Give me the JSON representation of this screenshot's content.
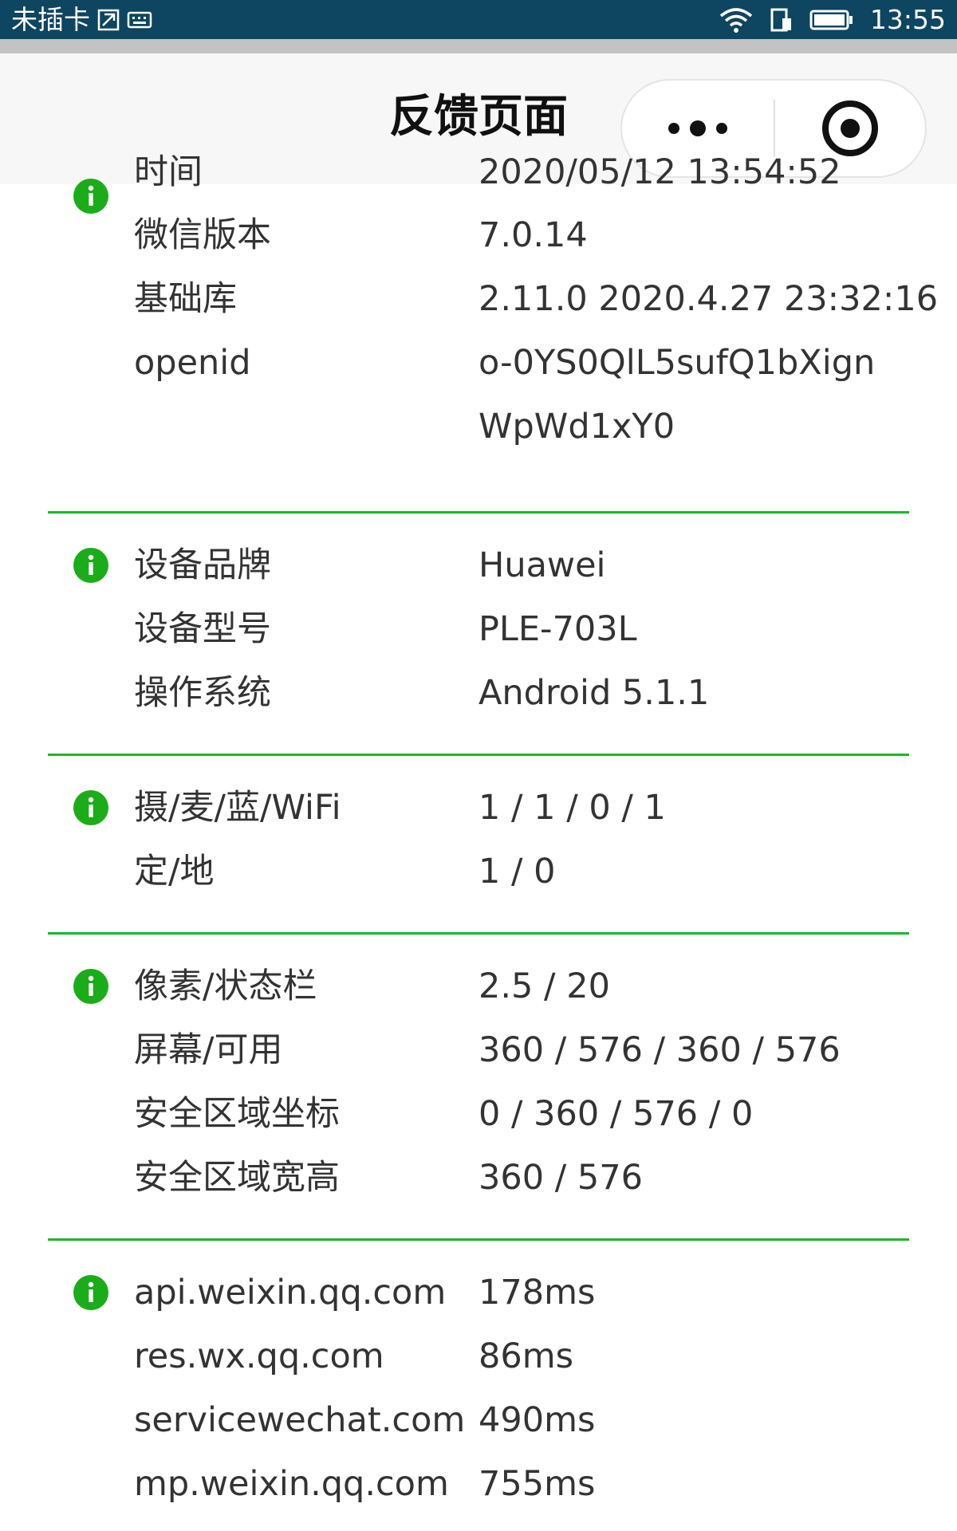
{
  "status_bar": {
    "carrier": "未插卡",
    "time": "13:55",
    "icons": [
      "sim-icon",
      "keyboard-icon",
      "wifi-icon",
      "sim-data-icon",
      "battery-icon"
    ]
  },
  "nav": {
    "title": "反馈页面",
    "more_icon": "more-dots-icon",
    "close_icon": "close-target-icon"
  },
  "colors": {
    "status_bar_bg": "#0e4560",
    "accent_green": "#18b92a",
    "info_icon": "#1aad19",
    "nav_bg": "#f7f7f7"
  },
  "sections": [
    {
      "icon": "info-icon",
      "rows": [
        {
          "label": "时间",
          "value": "2020/05/12 13:54:52"
        },
        {
          "label": "微信版本",
          "value": "7.0.14"
        },
        {
          "label": "基础库",
          "value": "2.11.0 2020.4.27 23:32:16"
        },
        {
          "label": "openid",
          "value": "o-0YS0QlL5sufQ1bXign"
        },
        {
          "label": "",
          "value": "WpWd1xY0"
        }
      ]
    },
    {
      "icon": "info-icon",
      "rows": [
        {
          "label": "设备品牌",
          "value": "Huawei"
        },
        {
          "label": "设备型号",
          "value": "PLE-703L"
        },
        {
          "label": "操作系统",
          "value": "Android 5.1.1"
        }
      ]
    },
    {
      "icon": "info-icon",
      "rows": [
        {
          "label": "摄/麦/蓝/WiFi",
          "value": "1 / 1 / 0 / 1"
        },
        {
          "label": "定/地",
          "value": "1 / 0"
        }
      ]
    },
    {
      "icon": "info-icon",
      "rows": [
        {
          "label": "像素/状态栏",
          "value": "2.5 / 20"
        },
        {
          "label": "屏幕/可用",
          "value": "360 / 576 / 360 / 576"
        },
        {
          "label": "安全区域坐标",
          "value": "0 / 360 / 576 / 0"
        },
        {
          "label": "安全区域宽高",
          "value": "360 / 576"
        }
      ]
    },
    {
      "icon": "info-icon",
      "rows": [
        {
          "label": "api.weixin.qq.com",
          "value": "178ms"
        },
        {
          "label": "res.wx.qq.com",
          "value": "86ms"
        },
        {
          "label": "servicewechat.com",
          "value": "490ms"
        },
        {
          "label": "mp.weixin.qq.com",
          "value": "755ms"
        }
      ]
    }
  ]
}
